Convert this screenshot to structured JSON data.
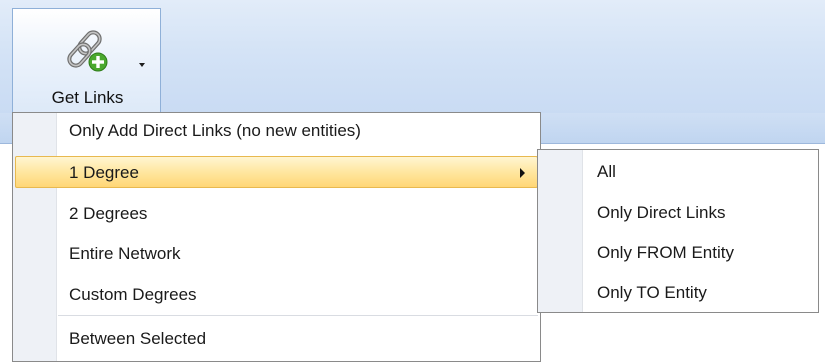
{
  "ribbon": {
    "button": {
      "label": "Get Links",
      "icon": "link-add-icon"
    }
  },
  "menu": {
    "items": [
      {
        "label": "Only Add Direct Links (no new entities)"
      },
      {
        "label": "1 Degree",
        "highlighted": true,
        "has_submenu": true
      },
      {
        "label": "2 Degrees"
      },
      {
        "label": "Entire Network"
      },
      {
        "label": "Custom Degrees"
      },
      {
        "label": "Between Selected"
      }
    ]
  },
  "submenu": {
    "items": [
      {
        "label": "All"
      },
      {
        "label": "Only Direct Links"
      },
      {
        "label": "Only FROM Entity"
      },
      {
        "label": "Only TO Entity"
      }
    ]
  },
  "colors": {
    "ribbon": "#d4e3f6",
    "highlight": "#ffe7a0",
    "highlight_border": "#e8b94f",
    "gutter": "#eef1f6"
  }
}
